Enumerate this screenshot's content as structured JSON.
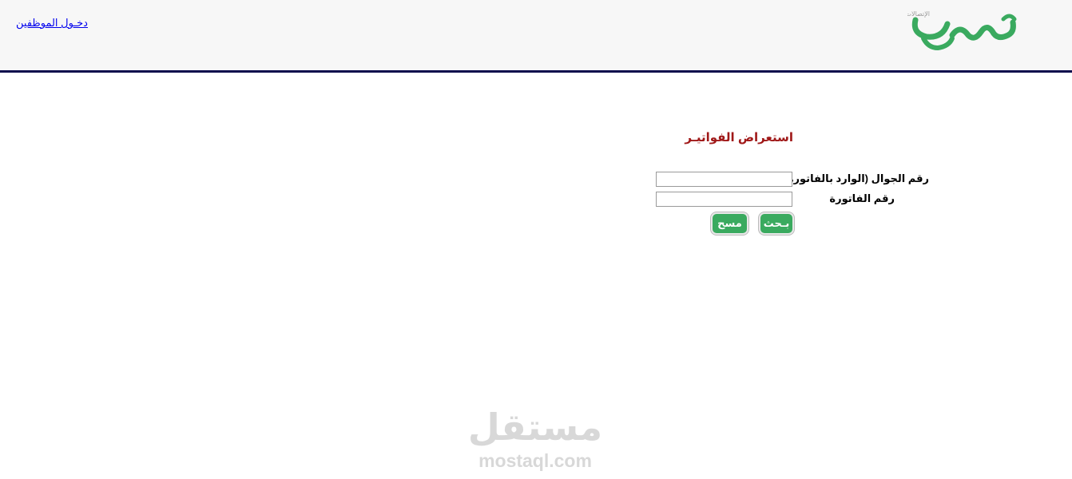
{
  "header": {
    "staff_login_link": "دخـول الموظفين",
    "logo_text": "الإتصالات",
    "brand_color": "#3aaa5f",
    "border_color": "#0c0c4d"
  },
  "form": {
    "title": "استعراض الفواتيـر",
    "fields": {
      "mobile_label": "رقم الجوال (الوارد بالفاتورة)",
      "mobile_value": "",
      "invoice_label": "رقم الفاتورة",
      "invoice_value": ""
    },
    "buttons": {
      "search_label": "بـحث",
      "clear_label": "مسح"
    },
    "title_color": "#a01818"
  },
  "watermark": {
    "arabic": "مستقل",
    "latin": "mostaql.com"
  }
}
